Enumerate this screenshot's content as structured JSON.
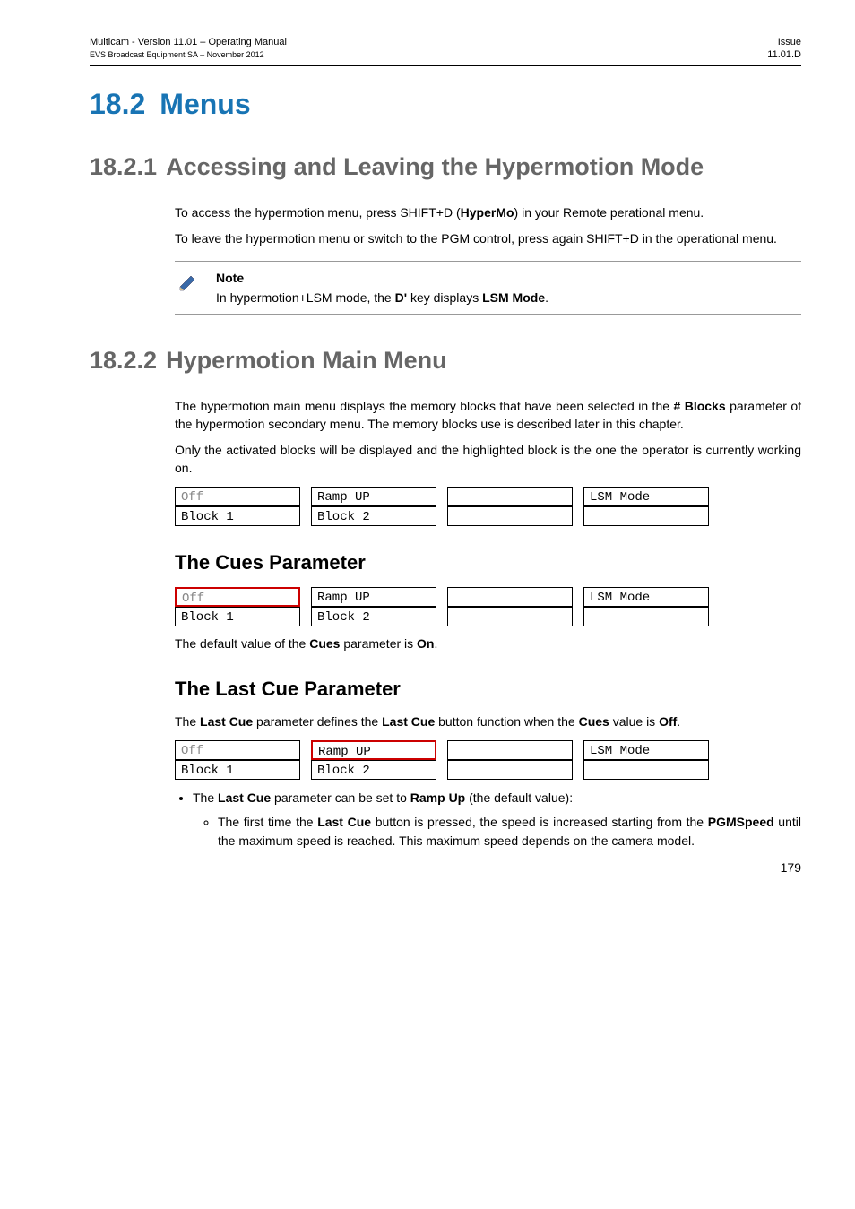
{
  "header": {
    "left_line1": "Multicam - Version 11.01 – Operating Manual",
    "left_line2": "EVS Broadcast Equipment SA – November 2012",
    "right_line1": "Issue",
    "right_line2": "11.01.D"
  },
  "section": {
    "num": "18.2",
    "title": "Menus"
  },
  "sub1": {
    "num": "18.2.1",
    "title": "Accessing and Leaving the Hypermotion Mode",
    "p1_a": "To access the hypermotion menu, press SHIFT+D (",
    "p1_b": "HyperMo",
    "p1_c": ") in your Remote perational menu.",
    "p2": "To leave the hypermotion menu or switch to the PGM control, press again SHIFT+D in the operational menu.",
    "note_label": "Note",
    "note_a": "In hypermotion+LSM mode, the ",
    "note_b": "D'",
    "note_c": " key displays ",
    "note_d": "LSM Mode",
    "note_e": "."
  },
  "sub2": {
    "num": "18.2.2",
    "title": "Hypermotion Main Menu",
    "p1_a": "The hypermotion main menu displays the memory blocks that have been selected in the ",
    "p1_b": "# Blocks",
    "p1_c": " parameter of the hypermotion secondary menu. The memory blocks use is described later in this chapter.",
    "p2": "Only the activated blocks will be displayed and the highlighted block is the one the operator is currently working on.",
    "menu1": {
      "c1_top": "Off",
      "c1_bot": "Block 1",
      "c2_top": "Ramp UP",
      "c2_bot": "Block 2",
      "c3_top": "",
      "c3_bot": "",
      "c4_top": "LSM Mode",
      "c4_bot": ""
    },
    "cues_title": "The Cues Parameter",
    "menu2": {
      "c1_top": "Off",
      "c1_bot": "Block 1",
      "c2_top": "Ramp UP",
      "c2_bot": "Block 2",
      "c3_top": "",
      "c3_bot": "",
      "c4_top": "LSM Mode",
      "c4_bot": ""
    },
    "cues_p_a": "The default value of the ",
    "cues_p_b": "Cues",
    "cues_p_c": " parameter is ",
    "cues_p_d": "On",
    "cues_p_e": ".",
    "lastcue_title": "The Last Cue Parameter",
    "lastcue_p_a": "The ",
    "lastcue_p_b": "Last Cue",
    "lastcue_p_c": " parameter defines the ",
    "lastcue_p_d": "Last Cue",
    "lastcue_p_e": " button function when the ",
    "lastcue_p_f": "Cues",
    "lastcue_p_g": " value is ",
    "lastcue_p_h": "Off",
    "lastcue_p_i": ".",
    "menu3": {
      "c1_top": "Off",
      "c1_bot": "Block 1",
      "c2_top": "Ramp UP",
      "c2_bot": "Block 2",
      "c3_top": "",
      "c3_bot": "",
      "c4_top": "LSM Mode",
      "c4_bot": ""
    },
    "bullet_a": "The ",
    "bullet_b": "Last Cue",
    "bullet_c": " parameter can be set to ",
    "bullet_d": "Ramp Up",
    "bullet_e": " (the default value):",
    "sub_a": "The first time the ",
    "sub_b": "Last Cue",
    "sub_c": " button is pressed, the speed is increased starting from the ",
    "sub_d": "PGMSpeed",
    "sub_e": " until the maximum speed is reached. This maximum speed depends on the camera model."
  },
  "page_number": "179"
}
